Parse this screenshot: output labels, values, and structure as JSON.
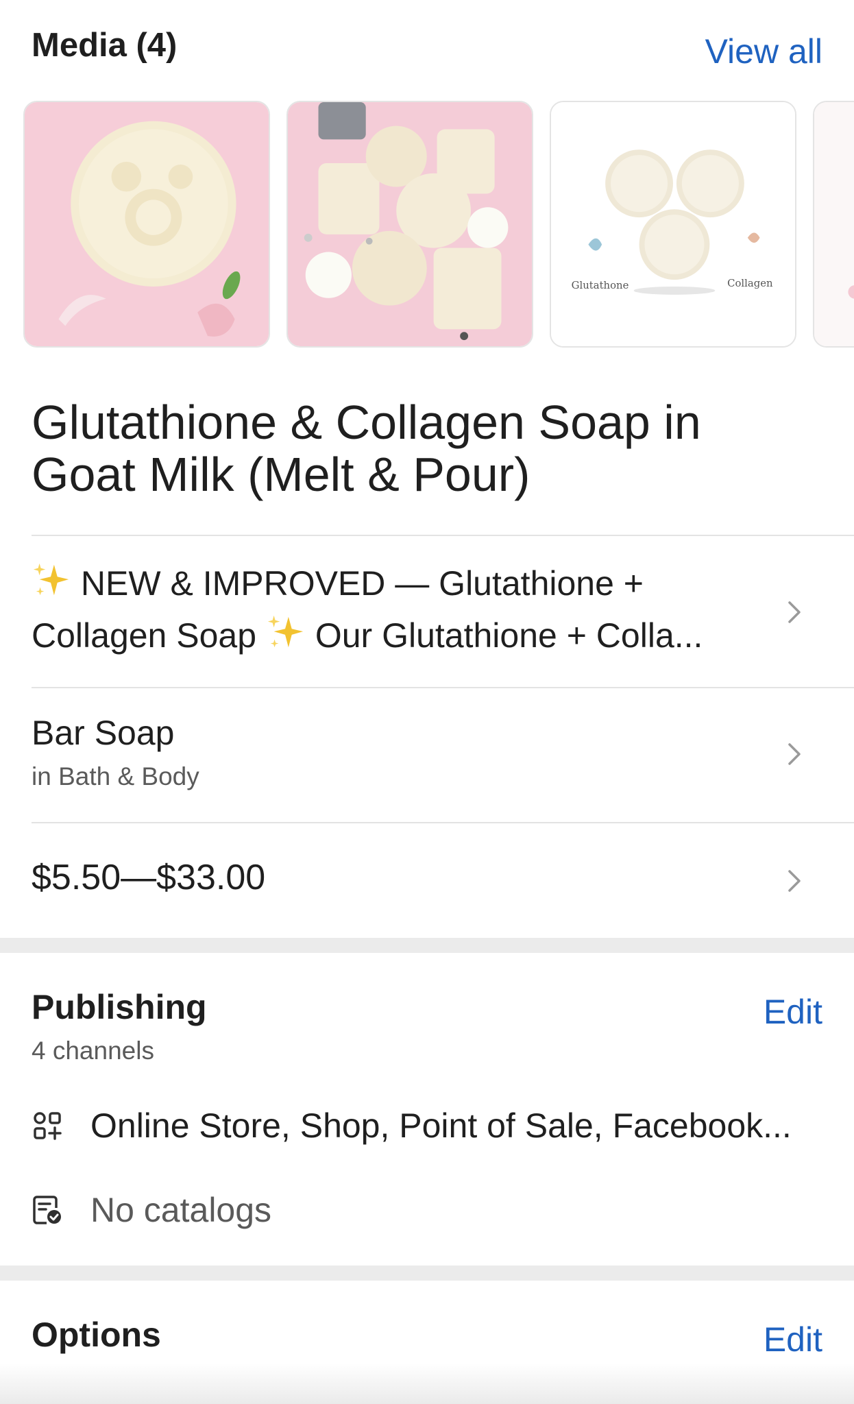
{
  "media": {
    "title": "Media (4)",
    "view_all": "View all",
    "thumbnails": [
      {
        "name": "soap-round-pink"
      },
      {
        "name": "soap-assortment"
      },
      {
        "name": "soap-labeled",
        "label_left": "Glutathone",
        "label_right": "Collagen"
      },
      {
        "name": "soap-partial"
      }
    ]
  },
  "product": {
    "title_line1": "Glutathione & Collagen Soap in",
    "title_line2": "Goat Milk (Melt & Pour)",
    "description_line1": "NEW & IMPROVED — Glutathione +",
    "description_line2a": "Collagen Soap",
    "description_line2b": "Our Glutathione + Colla...",
    "category": "Bar Soap",
    "category_parent": "in Bath & Body",
    "price": "$5.50—$33.00"
  },
  "publishing": {
    "title": "Publishing",
    "subtitle": "4 channels",
    "edit": "Edit",
    "channels": "Online Store, Shop, Point of Sale, Facebook...",
    "catalogs": "No catalogs"
  },
  "options": {
    "title": "Options",
    "edit": "Edit"
  },
  "colors": {
    "link": "#1f62c0",
    "sparkle": "#f2c230"
  }
}
